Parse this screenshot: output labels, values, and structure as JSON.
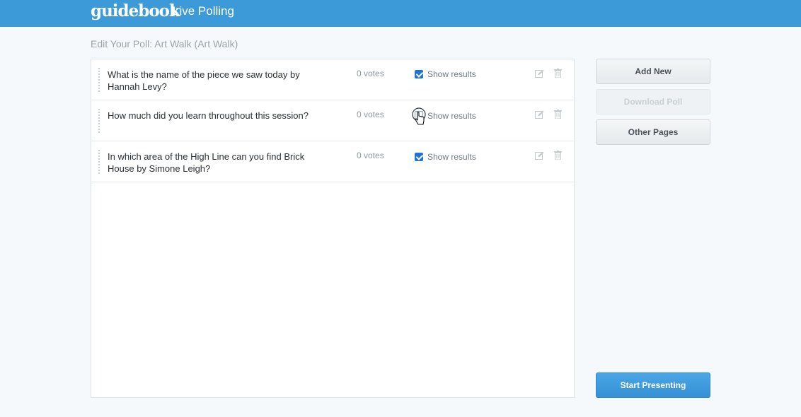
{
  "header": {
    "logo": "guidebook",
    "app_title": "Live Polling"
  },
  "page": {
    "title": "Edit Your Poll: Art Walk (Art Walk)"
  },
  "questions": [
    {
      "text": "What is the name of the piece we saw today by Hannah Levy?",
      "votes": "0 votes",
      "show_results_label": "Show results",
      "show_results_checked": true
    },
    {
      "text": "How much did you learn throughout this session?",
      "votes": "0 votes",
      "show_results_label": "Show results",
      "show_results_checked": false
    },
    {
      "text": "In which area of the High Line can you find Brick House by Simone Leigh?",
      "votes": "0 votes",
      "show_results_label": "Show results",
      "show_results_checked": true
    }
  ],
  "sidebar": {
    "add_new_label": "Add New",
    "download_poll_label": "Download Poll",
    "other_pages_label": "Other Pages",
    "start_presenting_label": "Start Presenting"
  },
  "colors": {
    "header_bg": "#3d9ad9",
    "checkbox_checked": "#1f73d6",
    "primary_button": "#3690d4"
  },
  "icons": {
    "edit": "pencil-square-icon",
    "delete": "trash-icon",
    "cursor": "hand-pointer-icon"
  }
}
